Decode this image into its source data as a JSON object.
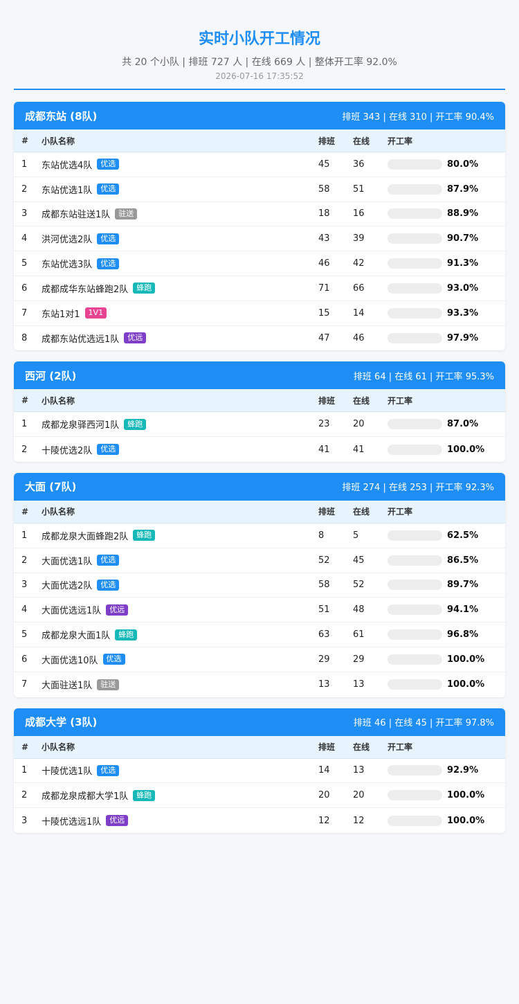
{
  "header": {
    "title": "实时小队开工情况",
    "summary": "共 20 个小队 | 排班 727 人 | 在线 669 人 | 整体开工率 92.0%",
    "timestamp": "2026-07-16 17:35:52"
  },
  "columns": {
    "idx": "#",
    "name": "小队名称",
    "scheduled": "排班",
    "online": "在线",
    "rate": "开工率"
  },
  "colors": {
    "primary": "#1e8ef5",
    "tag_优选": "#1e8ef5",
    "tag_蜂跑": "#16b8b8",
    "tag_驻送": "#999999",
    "tag_1V1": "#e84393",
    "tag_优远": "#7e3ec8"
  },
  "sections": [
    {
      "name": "成都东站 (8队)",
      "stats": "排班 343 | 在线 310 | 开工率 90.4%",
      "rows": [
        {
          "idx": "1",
          "name": "东站优选4队",
          "tag": "优选",
          "scheduled": "45",
          "online": "36",
          "rate": "80.0%"
        },
        {
          "idx": "2",
          "name": "东站优选1队",
          "tag": "优选",
          "scheduled": "58",
          "online": "51",
          "rate": "87.9%"
        },
        {
          "idx": "3",
          "name": "成都东站驻送1队",
          "tag": "驻送",
          "scheduled": "18",
          "online": "16",
          "rate": "88.9%"
        },
        {
          "idx": "4",
          "name": "洪河优选2队",
          "tag": "优选",
          "scheduled": "43",
          "online": "39",
          "rate": "90.7%"
        },
        {
          "idx": "5",
          "name": "东站优选3队",
          "tag": "优选",
          "scheduled": "46",
          "online": "42",
          "rate": "91.3%"
        },
        {
          "idx": "6",
          "name": "成都成华东站蜂跑2队",
          "tag": "蜂跑",
          "scheduled": "71",
          "online": "66",
          "rate": "93.0%"
        },
        {
          "idx": "7",
          "name": "东站1对1",
          "tag": "1V1",
          "scheduled": "15",
          "online": "14",
          "rate": "93.3%"
        },
        {
          "idx": "8",
          "name": "成都东站优选远1队",
          "tag": "优远",
          "scheduled": "47",
          "online": "46",
          "rate": "97.9%"
        }
      ]
    },
    {
      "name": "西河 (2队)",
      "stats": "排班 64 | 在线 61 | 开工率 95.3%",
      "rows": [
        {
          "idx": "1",
          "name": "成都龙泉驿西河1队",
          "tag": "蜂跑",
          "scheduled": "23",
          "online": "20",
          "rate": "87.0%"
        },
        {
          "idx": "2",
          "name": "十陵优选2队",
          "tag": "优选",
          "scheduled": "41",
          "online": "41",
          "rate": "100.0%"
        }
      ]
    },
    {
      "name": "大面 (7队)",
      "stats": "排班 274 | 在线 253 | 开工率 92.3%",
      "rows": [
        {
          "idx": "1",
          "name": "成都龙泉大面蜂跑2队",
          "tag": "蜂跑",
          "scheduled": "8",
          "online": "5",
          "rate": "62.5%"
        },
        {
          "idx": "2",
          "name": "大面优选1队",
          "tag": "优选",
          "scheduled": "52",
          "online": "45",
          "rate": "86.5%"
        },
        {
          "idx": "3",
          "name": "大面优选2队",
          "tag": "优选",
          "scheduled": "58",
          "online": "52",
          "rate": "89.7%"
        },
        {
          "idx": "4",
          "name": "大面优选远1队",
          "tag": "优远",
          "scheduled": "51",
          "online": "48",
          "rate": "94.1%"
        },
        {
          "idx": "5",
          "name": "成都龙泉大面1队",
          "tag": "蜂跑",
          "scheduled": "63",
          "online": "61",
          "rate": "96.8%"
        },
        {
          "idx": "6",
          "name": "大面优选10队",
          "tag": "优选",
          "scheduled": "29",
          "online": "29",
          "rate": "100.0%"
        },
        {
          "idx": "7",
          "name": "大面驻送1队",
          "tag": "驻送",
          "scheduled": "13",
          "online": "13",
          "rate": "100.0%"
        }
      ]
    },
    {
      "name": "成都大学 (3队)",
      "stats": "排班 46 | 在线 45 | 开工率 97.8%",
      "rows": [
        {
          "idx": "1",
          "name": "十陵优选1队",
          "tag": "优选",
          "scheduled": "14",
          "online": "13",
          "rate": "92.9%"
        },
        {
          "idx": "2",
          "name": "成都龙泉成都大学1队",
          "tag": "蜂跑",
          "scheduled": "20",
          "online": "20",
          "rate": "100.0%"
        },
        {
          "idx": "3",
          "name": "十陵优选远1队",
          "tag": "优远",
          "scheduled": "12",
          "online": "12",
          "rate": "100.0%"
        }
      ]
    }
  ]
}
